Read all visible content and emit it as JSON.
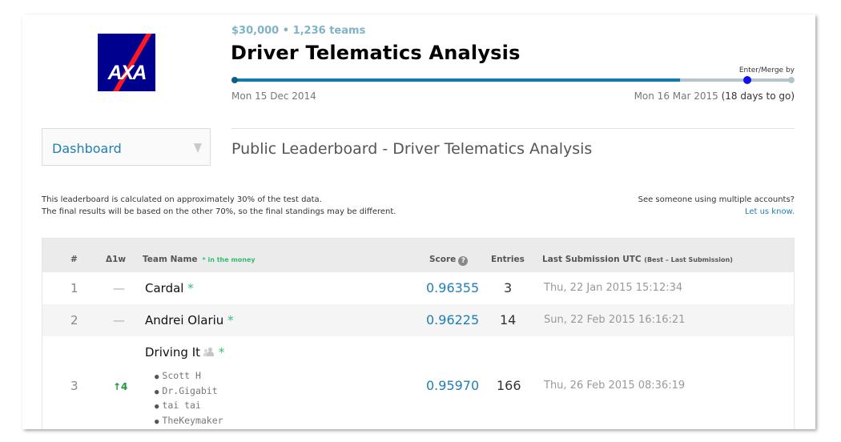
{
  "logo": {
    "text": "AXA"
  },
  "competition": {
    "prize_line": "$30,000 • 1,236 teams",
    "title": "Driver Telematics Analysis",
    "merge_label": "Enter/Merge by",
    "start_date": "Mon 15 Dec 2014",
    "end_date": "Mon 16 Mar 2015",
    "days_to_go": "(18 days to go)",
    "progress_fraction": 0.8
  },
  "nav": {
    "dashboard_label": "Dashboard"
  },
  "leaderboard": {
    "heading": "Public Leaderboard - Driver Telematics Analysis",
    "note_line1": "This leaderboard is calculated on approximately 30% of the test data.",
    "note_line2": "The final results will be based on the other 70%, so the final standings may be different.",
    "multi_accounts_q": "See someone using multiple accounts?",
    "let_us_know": "Let us know.",
    "columns": {
      "rank": "#",
      "change": "Δ1w",
      "team": "Team Name",
      "in_money": "* in the money",
      "score": "Score",
      "entries": "Entries",
      "last_submission": "Last Submission UTC",
      "last_submission_note": "(Best – Last Submission)"
    },
    "rows": [
      {
        "rank": "1",
        "change": "—",
        "team": "Cardal",
        "star": "*",
        "score": "0.96355",
        "entries": "3",
        "last": "Thu, 22 Jan 2015 15:12:34"
      },
      {
        "rank": "2",
        "change": "—",
        "team": "Andrei Olariu",
        "star": "*",
        "score": "0.96225",
        "entries": "14",
        "last": "Sun, 22 Feb 2015 16:16:21"
      },
      {
        "rank": "3",
        "change": "↑4",
        "team": "Driving It",
        "star": "*",
        "score": "0.95970",
        "entries": "166",
        "last": "Thu, 26 Feb 2015 08:36:19",
        "members": [
          "Scott H",
          "Dr.Gigabit",
          "tai tai",
          "TheKeymaker"
        ]
      }
    ]
  }
}
